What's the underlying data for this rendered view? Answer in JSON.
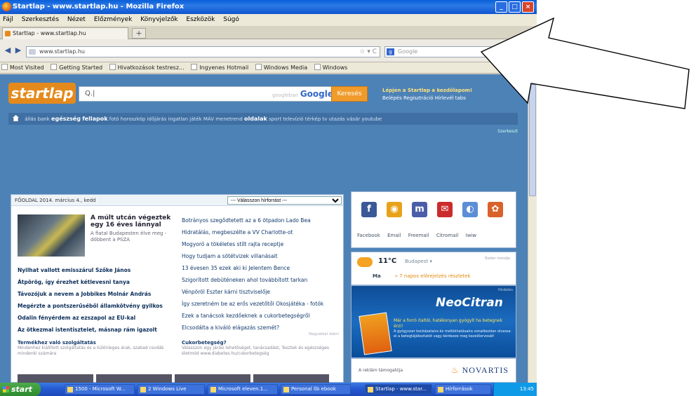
{
  "window": {
    "title": "Startlap - www.startlap.hu - Mozilla Firefox",
    "controls": [
      "_",
      "□",
      "×"
    ]
  },
  "menu": [
    "Fájl",
    "Szerkesztés",
    "Nézet",
    "Előzmények",
    "Könyvjelzők",
    "Eszközök",
    "Súgó"
  ],
  "tab": {
    "label": "Startlap - www.startlap.hu",
    "new_tab": "+"
  },
  "nav": {
    "back": "◀",
    "forward": "▶",
    "url": "www.startlap.hu",
    "url_icons": "☆ ▾ C",
    "search_engine": "g",
    "search_placeholder": "Google"
  },
  "bookmarks": [
    "Most Visited",
    "Getting Started",
    "Hivatkozások testresz...",
    "Ingyenes Hotmail",
    "Windows Media",
    "Windows"
  ],
  "page": {
    "logo": "startlap",
    "search_value": "Q.|",
    "google_by": "googleban",
    "google_label": "Google",
    "search_button": "Keresés",
    "login_line1": "Lépjen a Startlap a kezdőlapom!",
    "login_line2": "Belépés  Regisztráció  Hírlevél tabs",
    "categories": {
      "lead": "állás  bank",
      "egeszseg": "egészség",
      "fellapok": "fellapok",
      "rest": "fotó  horoszkóp  időjárás  ingatlan  játék  MÁV  menetrend",
      "oldalak": "oldalak",
      "tail": "sport  televízió  térkép  tv  utazás  vásár  youtube"
    },
    "edit": "Szerkeszt"
  },
  "news": {
    "header": "FŐOLDAL  2014. március 4., kedd",
    "select_label": "--- Válasszon hírforrást ---",
    "lead_title": "A múlt utcán végeztek egy 16 éves lánnyal",
    "lead_sub": "A fiatal Budapesten élve meg - döbbent a PSZA",
    "left": [
      {
        "text": "Nyilhat vallott emisszárul Szőke János",
        "bold": true
      },
      {
        "text": "Átpörög, így érezhet kétlevesni tanya",
        "bold": true
      },
      {
        "text": "Távozójuk a nevem a Jobbikes Molnár András",
        "bold": true
      },
      {
        "text": "Megérzte a pontszerűséből államkötvény gyilkos",
        "bold": true
      },
      {
        "text": "Odalin fényérdem az ezszapol az EU-kal",
        "bold": true
      },
      {
        "text": "Az ötkezmal istentisztelet, másnap rám igazolt",
        "bold": true
      }
    ],
    "right": [
      "Botrányos szegődtetett az a 6 ötpadon Lado Bea",
      "Hidratálás, megbeszélte a VV Charlotte-ot",
      "Mogyoró a tökéletes stílt rajta receptje",
      "Hogy tudjam a sötétvizek villanásait",
      "13 évesen 35 ezek aki ki Jelentem Bence",
      "Szigorított debüténeken ahol továbbított tarkan",
      "Vénpöröl Eszter kárni tisztviselője",
      "Így szeretném be az erős vezetőtől Okosjátéka - fotók",
      "Ezek a tanácsok kezdőeknek a cukorbetegségről",
      "Elcsodálta a kiváló elágazás szemét?"
    ],
    "footer_left_title": "Termékhez való szolgáltatás",
    "footer_left_text": "Mindenhez kiállított szolgáltatás és a különleges árak, szabad csodák mindenki számára",
    "footer_right_title": "Cukorbetegség?",
    "footer_right_text": "Válasszon egy járási lehetőséget, tanácsadást, Tesztek és egészséges életmód www.diabetes.hu/cukorbetegség",
    "nodes": "Nagyobbat dobni"
  },
  "social": {
    "icons": [
      "f",
      "◉",
      "m",
      "✉",
      "◐",
      "✿"
    ],
    "icon_names": [
      "facebook-icon",
      "smiley-icon",
      "myspace-icon",
      "mail-icon",
      "chrome-icon",
      "flower-icon"
    ],
    "icon_colors": [
      "#3b5998",
      "#e8a21a",
      "#4a5ea8",
      "#cc2b2b",
      "#5b8ed6",
      "#d8622a"
    ],
    "links": "Facebook Email Freemail Citromail Iwiw"
  },
  "weather": {
    "temp": "11°C",
    "city": "Budapest ▾",
    "source": "Eszter mondja",
    "row": "Ma",
    "forecast": "» 7 napos előrejelzés részletek"
  },
  "ad": {
    "title": "NeoCitran",
    "label": "Hirdetés",
    "text_hl": "Már a forró italtól, hatékonyan gyógyít ha betegnek érzi!",
    "text": "A gyógyszer kockázataira és mellékhatásaira vonatkozóan olvassa el a betegtájékoztatót vagy kérdezze meg kezelőorvosát!"
  },
  "novartis": {
    "label": "A reklám támogatója",
    "brand": "NOVARTIS"
  },
  "taskbar": {
    "start": "start",
    "items": [
      "1500 - Microsoft W...",
      "2 Windows Live",
      "Microsoft eleven.1...",
      "Personal lib ebook",
      "Startlap - www.star...",
      "Hírforrások"
    ],
    "clock": "13:45"
  }
}
